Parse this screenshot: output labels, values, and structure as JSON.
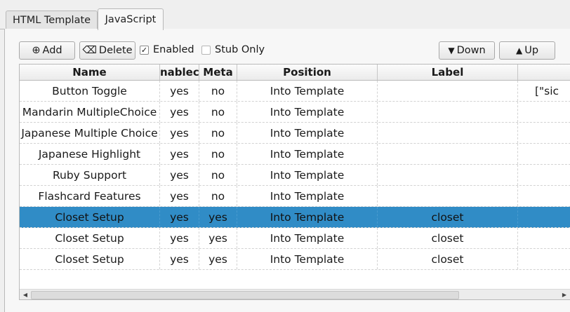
{
  "tabs": [
    {
      "label": "HTML Template",
      "active": false
    },
    {
      "label": "JavaScript",
      "active": true
    }
  ],
  "toolbar": {
    "add_icon": "⊕",
    "add_label": "Add",
    "delete_icon": "⌫",
    "delete_label": "Delete",
    "enabled_label": "Enabled",
    "enabled_checked": true,
    "enabled_mark": "✓",
    "stub_label": "Stub Only",
    "stub_checked": false,
    "down_icon": "▼",
    "down_label": "Down",
    "up_icon": "▲",
    "up_label": "Up"
  },
  "table": {
    "columns": [
      "Name",
      "Enabled",
      "Meta",
      "Position",
      "Label",
      ""
    ],
    "header_display": [
      "Name",
      "nableс",
      "Meta",
      "Position",
      "Label",
      ""
    ],
    "rows": [
      {
        "name": "Button Toggle",
        "enabled": "yes",
        "meta": "no",
        "position": "Into Template",
        "label": "",
        "extra": "[\"sic"
      },
      {
        "name": "Mandarin MultipleChoice",
        "enabled": "yes",
        "meta": "no",
        "position": "Into Template",
        "label": "",
        "extra": ""
      },
      {
        "name": "Japanese Multiple Choice",
        "enabled": "yes",
        "meta": "no",
        "position": "Into Template",
        "label": "",
        "extra": ""
      },
      {
        "name": "Japanese Highlight",
        "enabled": "yes",
        "meta": "no",
        "position": "Into Template",
        "label": "",
        "extra": ""
      },
      {
        "name": "Ruby Support",
        "enabled": "yes",
        "meta": "no",
        "position": "Into Template",
        "label": "",
        "extra": ""
      },
      {
        "name": "Flashcard Features",
        "enabled": "yes",
        "meta": "no",
        "position": "Into Template",
        "label": "",
        "extra": ""
      },
      {
        "name": "Closet Setup",
        "enabled": "yes",
        "meta": "yes",
        "position": "Into Template",
        "label": "closet",
        "extra": "",
        "selected": true
      },
      {
        "name": "Closet Setup",
        "enabled": "yes",
        "meta": "yes",
        "position": "Into Template",
        "label": "closet",
        "extra": ""
      },
      {
        "name": "Closet Setup",
        "enabled": "yes",
        "meta": "yes",
        "position": "Into Template",
        "label": "closet",
        "extra": ""
      }
    ]
  },
  "scrollbar": {
    "left_icon": "◀",
    "right_icon": "▶"
  },
  "colors": {
    "selection": "#308cc6",
    "background": "#efefef"
  }
}
